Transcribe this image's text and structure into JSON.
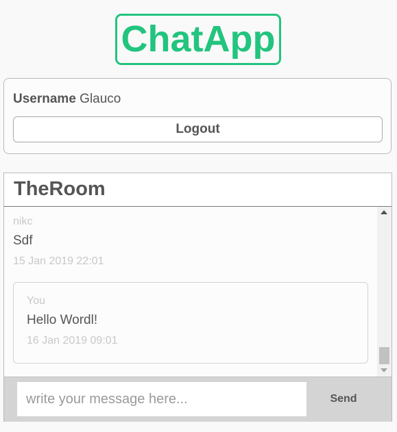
{
  "app": {
    "title": "ChatApp",
    "accent_color": "#22c47e"
  },
  "user_panel": {
    "username_label": "Username",
    "username_value": "Glauco",
    "logout_label": "Logout"
  },
  "room": {
    "title": "TheRoom",
    "messages": [
      {
        "author": "nikc",
        "text": "Sdf",
        "time": "15 Jan 2019 22:01",
        "own": false
      },
      {
        "author": "You",
        "text": "Hello Wordl!",
        "time": "16 Jan 2019 09:01",
        "own": true
      }
    ],
    "composer": {
      "placeholder": "write your message here...",
      "value": "",
      "send_label": "Send"
    }
  }
}
